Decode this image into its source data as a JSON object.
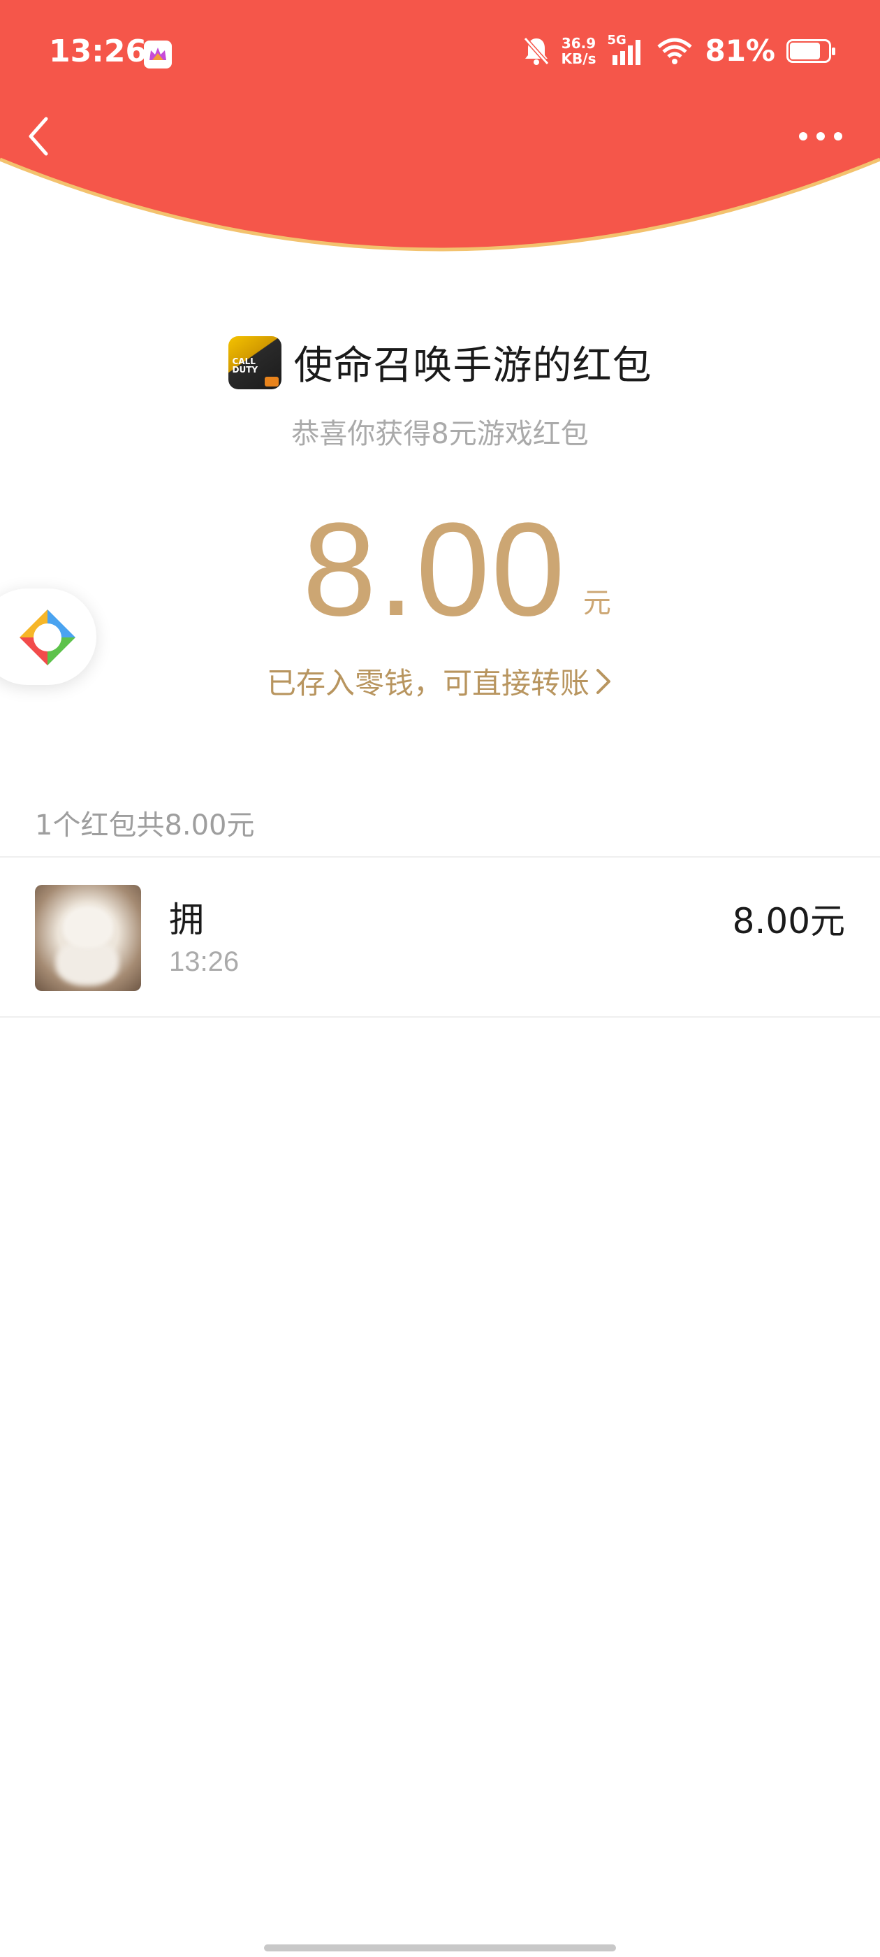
{
  "status_bar": {
    "time": "13:26",
    "net_speed_value": "36.9",
    "net_speed_unit": "KB/s",
    "network_type": "5G",
    "battery_percent": "81%",
    "battery_level": 0.81,
    "icons": [
      "app-icon",
      "mute-bell-icon",
      "signal-icon",
      "wifi-icon",
      "battery-icon"
    ]
  },
  "header": {
    "back_icon": "chevron-left-icon",
    "more_icon": "more-dots-icon",
    "background_color": "#f5564a",
    "border_color": "#f3c26e"
  },
  "packet": {
    "title": "使命召唤手游的红包",
    "game_icon_text": "CALL DUTY",
    "subtitle": "恭喜你获得8元游戏红包",
    "amount": "8.00",
    "amount_unit": "元",
    "deposit_text": "已存入零钱，可直接转账",
    "accent_color": "#cca673"
  },
  "summary": {
    "text": "1个红包共8.00元"
  },
  "records": [
    {
      "name": "拥",
      "time": "13:26",
      "amount": "8.00元"
    }
  ]
}
